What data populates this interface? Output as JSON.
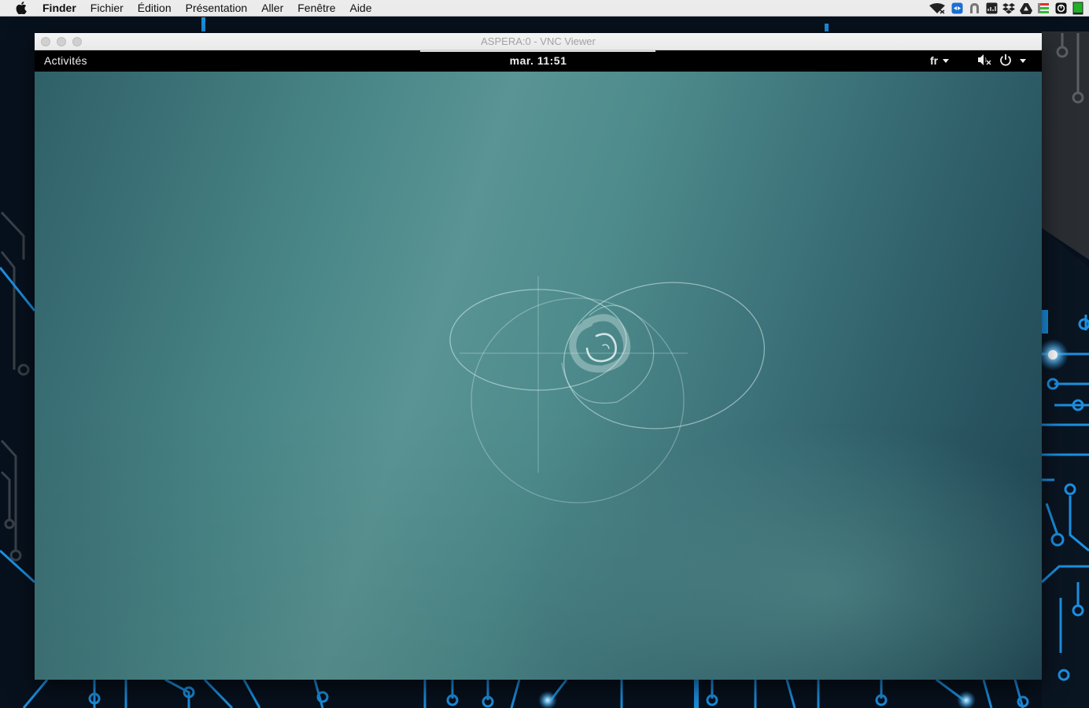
{
  "mac_menubar": {
    "apple_icon": "apple-icon",
    "app_name": "Finder",
    "menus": [
      "Fichier",
      "Édition",
      "Présentation",
      "Aller",
      "Fenêtre",
      "Aide"
    ],
    "status_icons": [
      "wifi-icon",
      "teamviewer-icon",
      "vpn-icon",
      "activity-monitor-icon",
      "dropbox-icon",
      "google-drive-icon",
      "istat-icon",
      "app-icon",
      "battery-icon"
    ]
  },
  "vnc_window": {
    "title": "ASPERA:0 - VNC Viewer"
  },
  "gnome_topbar": {
    "activities": "Activités",
    "clock": "mar. 11:51",
    "language": "fr",
    "status_icons": [
      "volume-muted-icon",
      "power-icon",
      "chevron-down-icon"
    ]
  },
  "desktop": {
    "logo": "debian-swirl-logo"
  },
  "colors": {
    "gnome_bar": "#000000",
    "desktop_teal": "#4a8788",
    "desktop_dark": "#1e4452",
    "wallpaper_circuit": "#1c8fe0"
  }
}
